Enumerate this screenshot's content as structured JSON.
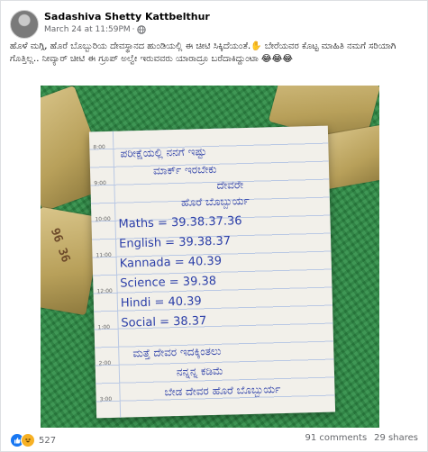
{
  "post": {
    "author": "Sadashiva Shetty Kattbelthur",
    "date": "March 24 at 11:59PM",
    "separator": "·",
    "caption": "ಹೊಳೆ ಮಗ್ಗಿ, ಹೊರೆ ಬೊಬ್ಬುರಿಯ ದೇವಸ್ಥಾನದ ಹುಂಡಿಯಲ್ಲಿ ಈ ಚೀಟಿ ಸಿಕ್ಕಿದೆಯಂತೆ.✋ ಬೇರೆಯವರ ಕೊಟ್ಟ ಮಾಹಿತಿ ನಮಗೆ ಸರಿಯಾಗಿ ಗೊತ್ತಿಲ್ಲ.. ನೀವ್ಯಾರ್ ಚೀಟಿ ಈ ಗ್ರೂಪ್ ಅಲ್ವೇ ಇರುವವರು ಯಾರಾದ್ರೂ ಬರೆದಾಕಿದ್ದುಂಟಾ 😂😂😂",
    "globe_icon": "globe-icon"
  },
  "photo": {
    "money_text": "96 36",
    "times": [
      "8:00",
      "9:00",
      "10:00",
      "11:00",
      "12:00",
      "1:00",
      "2:00",
      "3:00"
    ],
    "note_lines": [
      "ಪರೀಕ್ಷೆಯಲ್ಲಿ ನನಗೆ ಇಷ್ಟು",
      "ಮಾರ್ಕ್ ಇರಬೇಕು",
      "ದೇವರೇ",
      "ಹೊರೆ ಬೊಬ್ಬುರ್ಯ"
    ],
    "subjects": [
      "Maths = 39.38.37.36",
      "English = 39.38.37",
      "Kannada = 40.39",
      "Science = 39.38",
      "Hindi = 40.39",
      "Social = 38.37"
    ],
    "closing_lines": [
      "ಮತ್ತೆ ದೇವರ ಇದಕ್ಕಿಂತಲು",
      "ನನ್ನನ್ನ ಕಡಿಮೆ",
      "ಬೇಡ ದೇವರ ಹೊರೆ ಬೊಬ್ಬುರ್ಯ"
    ]
  },
  "footer": {
    "reaction_count": "527",
    "comments": "91 comments",
    "shares": "29 shares",
    "like_icon": "like-icon",
    "haha_icon": "haha-icon"
  }
}
